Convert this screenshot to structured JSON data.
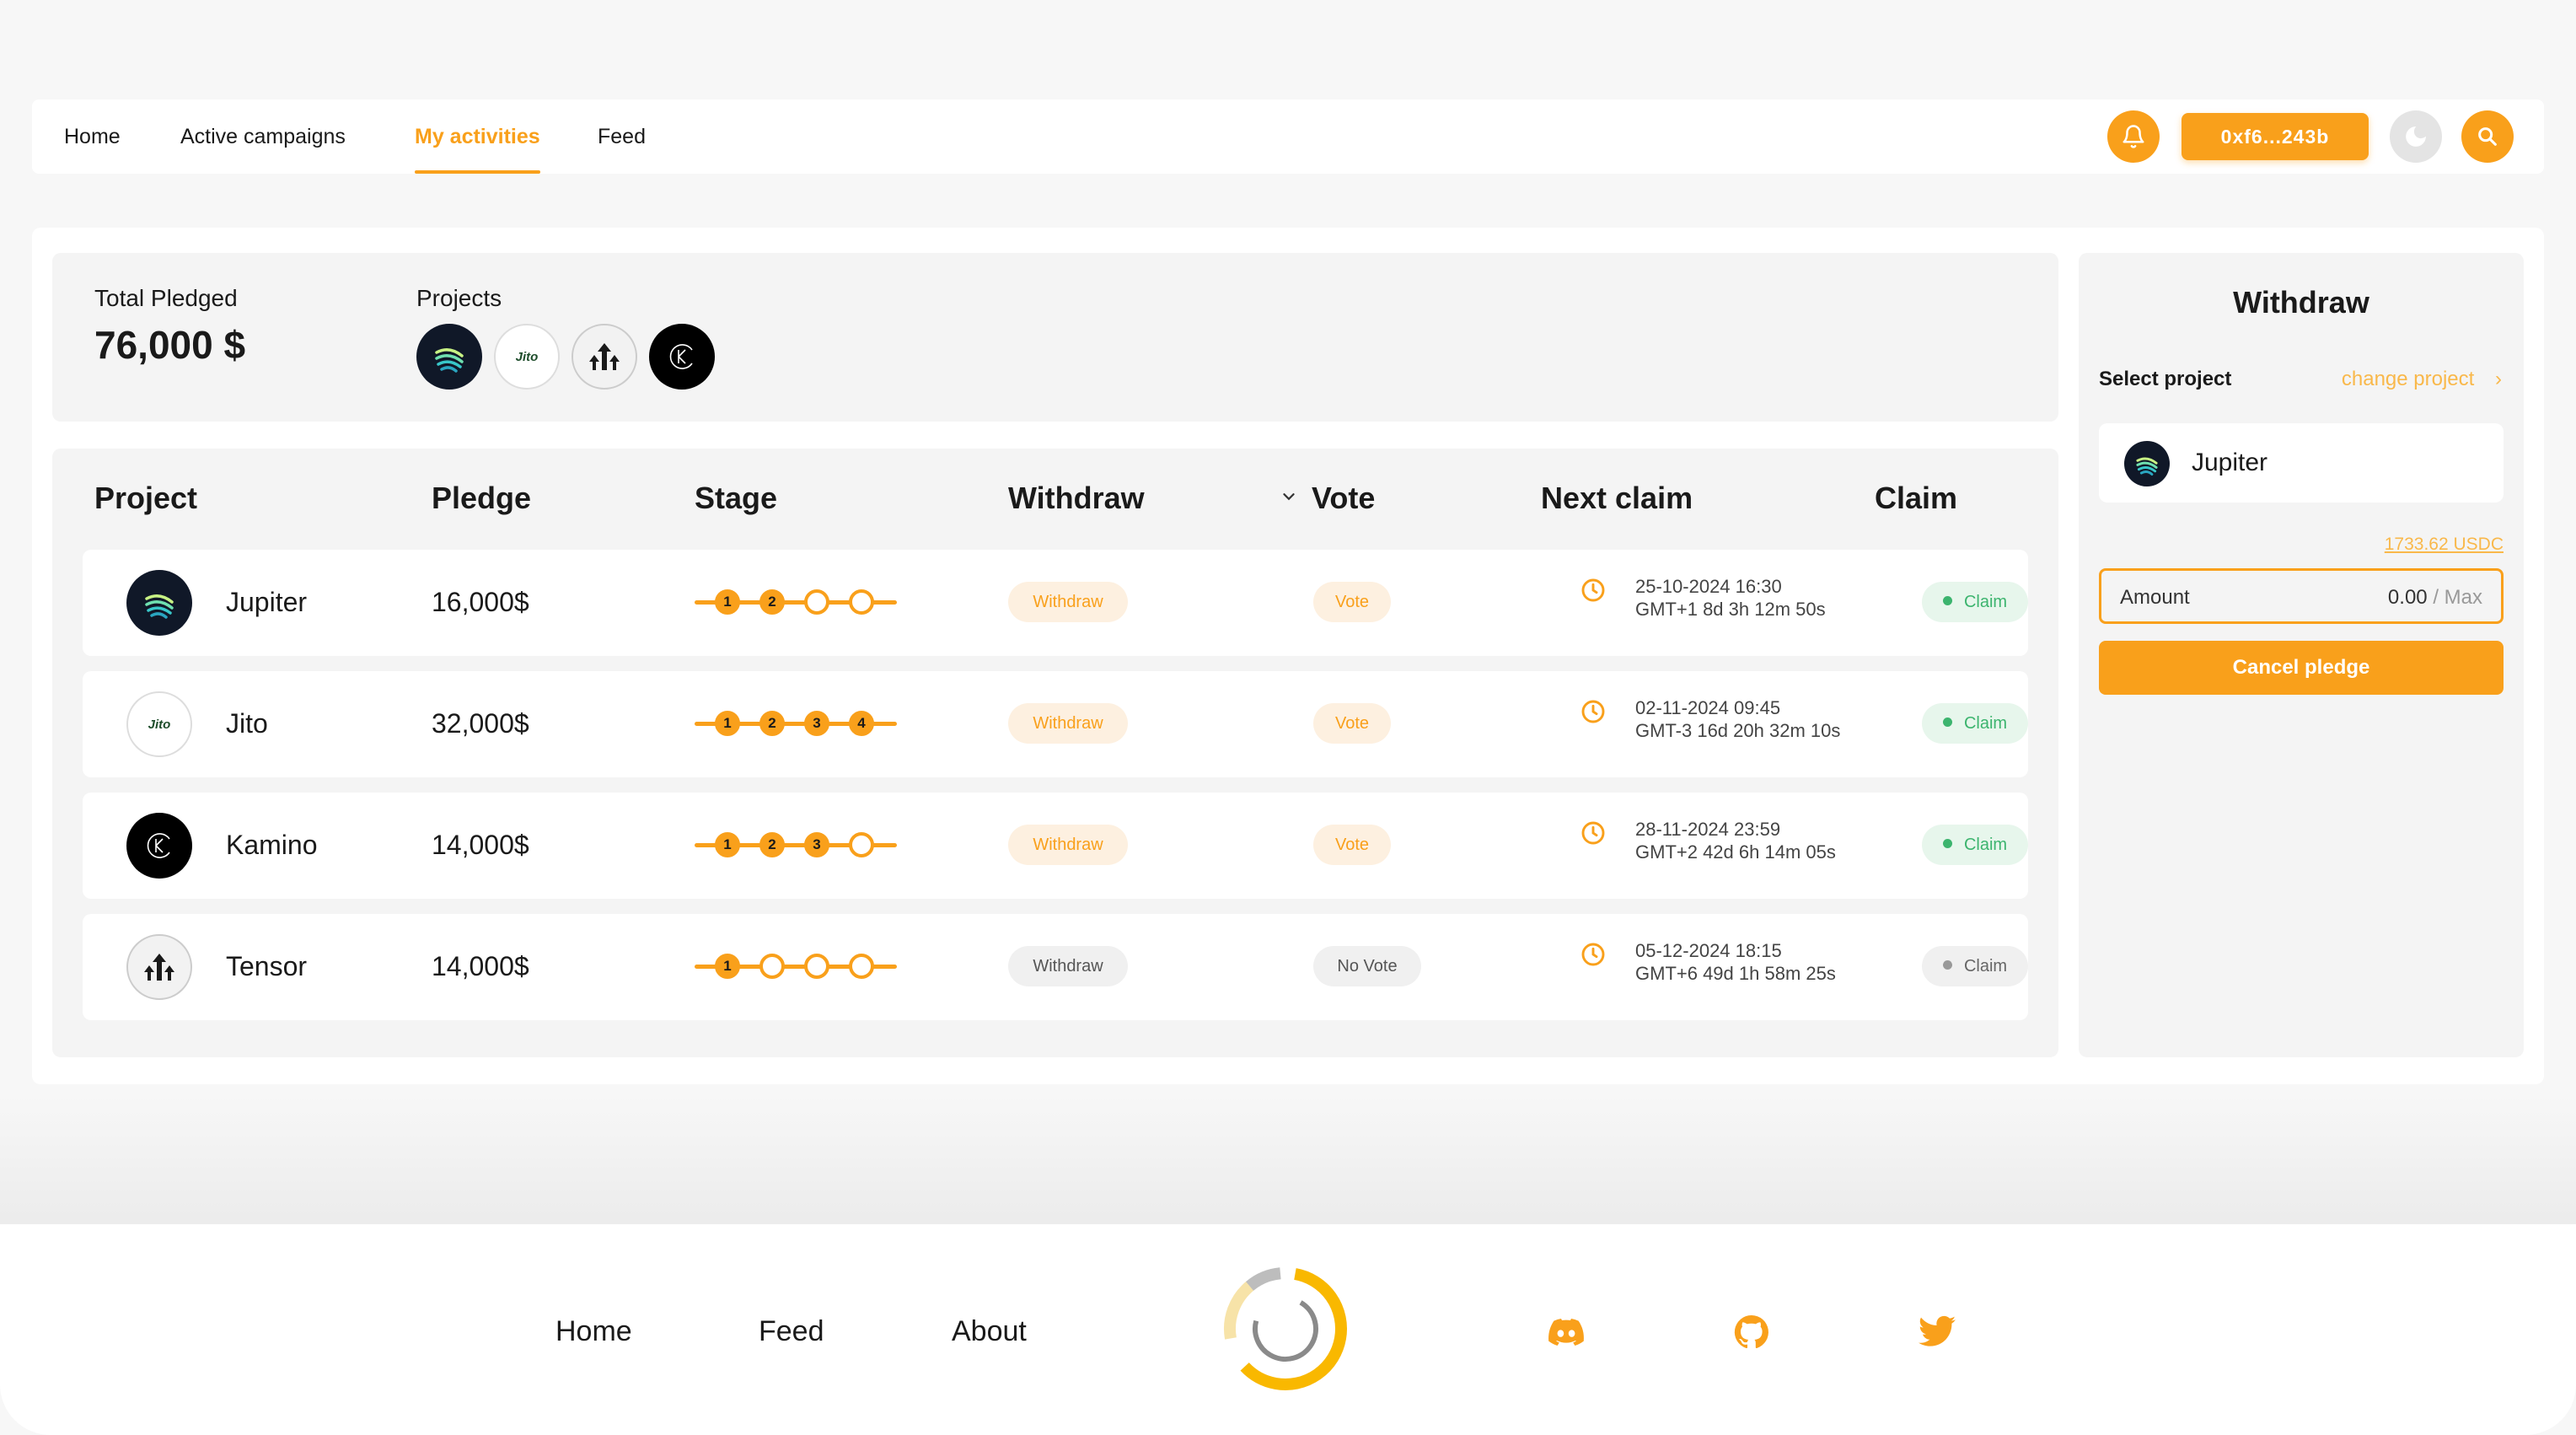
{
  "nav": {
    "links": [
      "Home",
      "Active campaigns",
      "My activities",
      "Feed"
    ],
    "active": "My activities",
    "wallet": "0xf6...243b",
    "icons": [
      "bell-icon",
      "moon-icon",
      "search-icon"
    ],
    "accent_color": "#f9a01b"
  },
  "summary": {
    "total_label": "Total Pledged",
    "total_value": "76,000 $",
    "projects_label": "Projects",
    "projects": [
      "Jupiter",
      "Jito",
      "Tensor",
      "Kamino"
    ]
  },
  "table": {
    "headers": [
      "Project",
      "Pledge",
      "Stage",
      "Withdraw",
      "Vote",
      "Next claim",
      "Claim"
    ],
    "rows": [
      {
        "name": "Jupiter",
        "logo": "jupiter-logo",
        "pledge": "16,000$",
        "stages_completed": 2,
        "stage_labels": [
          "1",
          "2"
        ],
        "withdraw": "Withdraw",
        "withdraw_active": true,
        "vote": "Vote",
        "vote_active": true,
        "claim_date": "25-10-2024 16:30",
        "claim_countdown": "GMT+1 8d 3h 12m 50s",
        "claim": "Claim",
        "claim_active": true
      },
      {
        "name": "Jito",
        "logo": "jito-logo",
        "pledge": "32,000$",
        "stages_completed": 4,
        "stage_labels": [
          "1",
          "2",
          "3",
          "4"
        ],
        "withdraw": "Withdraw",
        "withdraw_active": true,
        "vote": "Vote",
        "vote_active": true,
        "claim_date": "02-11-2024 09:45",
        "claim_countdown": "GMT-3 16d 20h 32m 10s",
        "claim": "Claim",
        "claim_active": true
      },
      {
        "name": "Kamino",
        "logo": "kamino-logo",
        "pledge": "14,000$",
        "stages_completed": 3,
        "stage_labels": [
          "1",
          "2",
          "3"
        ],
        "withdraw": "Withdraw",
        "withdraw_active": true,
        "vote": "Vote",
        "vote_active": true,
        "claim_date": "28-11-2024 23:59",
        "claim_countdown": "GMT+2 42d 6h 14m 05s",
        "claim": "Claim",
        "claim_active": true
      },
      {
        "name": "Tensor",
        "logo": "tensor-logo",
        "pledge": "14,000$",
        "stages_completed": 1,
        "stage_labels": [
          "1"
        ],
        "withdraw": "Withdraw",
        "withdraw_active": false,
        "vote": "No Vote",
        "vote_active": false,
        "claim_date": "05-12-2024 18:15",
        "claim_countdown": "GMT+6 49d 1h 58m 25s",
        "claim": "Claim",
        "claim_active": false
      }
    ]
  },
  "withdraw_panel": {
    "title": "Withdraw",
    "select_label": "Select project",
    "change_label": "change project",
    "selected_project": "Jupiter",
    "balance": "1733.62 USDC",
    "amount_label": "Amount",
    "amount_value": "0.00",
    "max_label": "Max",
    "cancel_label": "Cancel pledge"
  },
  "footer": {
    "links": [
      "Home",
      "Feed",
      "About"
    ],
    "social_icons": [
      "discord-icon",
      "github-icon",
      "twitter-icon"
    ]
  }
}
